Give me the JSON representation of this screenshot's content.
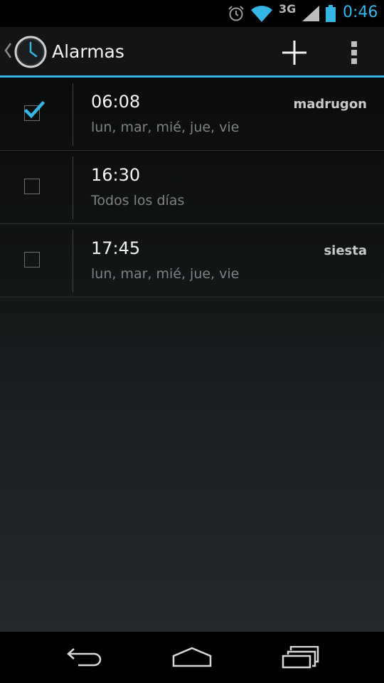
{
  "status_bar": {
    "network": "3G",
    "time": "0:46",
    "icons": [
      "alarm-icon",
      "wifi-icon",
      "signal-icon",
      "battery-icon"
    ]
  },
  "action_bar": {
    "title": "Alarmas",
    "icons": [
      "up-caret-icon",
      "clock-app-icon",
      "add-icon",
      "overflow-menu-icon"
    ]
  },
  "alarms": [
    {
      "time": "06:08",
      "days": "lun, mar, mié, jue, vie",
      "label": "madrugon",
      "enabled": true
    },
    {
      "time": "16:30",
      "days": "Todos los días",
      "label": "",
      "enabled": false
    },
    {
      "time": "17:45",
      "days": "lun, mar, mié, jue, vie",
      "label": "siesta",
      "enabled": false
    }
  ],
  "nav_bar": {
    "icons": [
      "back-icon",
      "home-icon",
      "recent-apps-icon"
    ]
  },
  "colors": {
    "accent": "#33b5e5",
    "background": "#000000",
    "action_bar": "#141414",
    "primary_text": "#f4f4f4",
    "secondary_text": "#7f8285"
  }
}
